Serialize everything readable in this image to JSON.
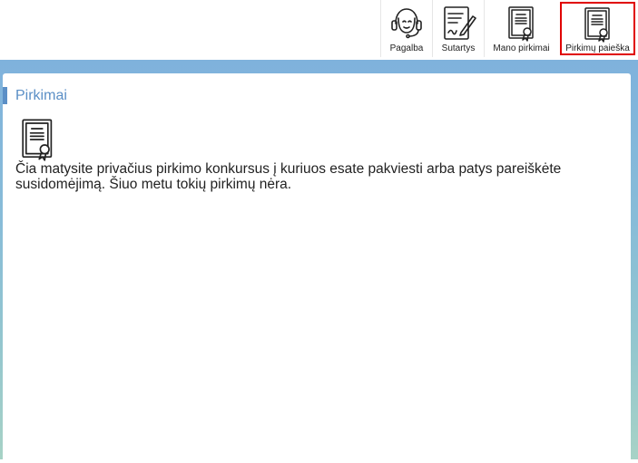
{
  "toolbar": {
    "items": [
      {
        "label": "Pagalba",
        "icon": "headset-support-icon"
      },
      {
        "label": "Sutartys",
        "icon": "contract-sign-icon"
      },
      {
        "label": "Mano pirkimai",
        "icon": "certificate-document-icon"
      },
      {
        "label": "Pirkimų paieška",
        "icon": "certificate-document-icon"
      }
    ],
    "active_index": 3,
    "active_color": "#e00000"
  },
  "panel": {
    "title": "Pirkimai",
    "title_color": "#5b8fc6",
    "icon": "certificate-document-icon",
    "message": "Čia matysite privačius pirkimo konkursus į kuriuos esate pakviesti arba patys pareiškėte susidomėjimą. Šiuo metu tokių pirkimų nėra."
  }
}
